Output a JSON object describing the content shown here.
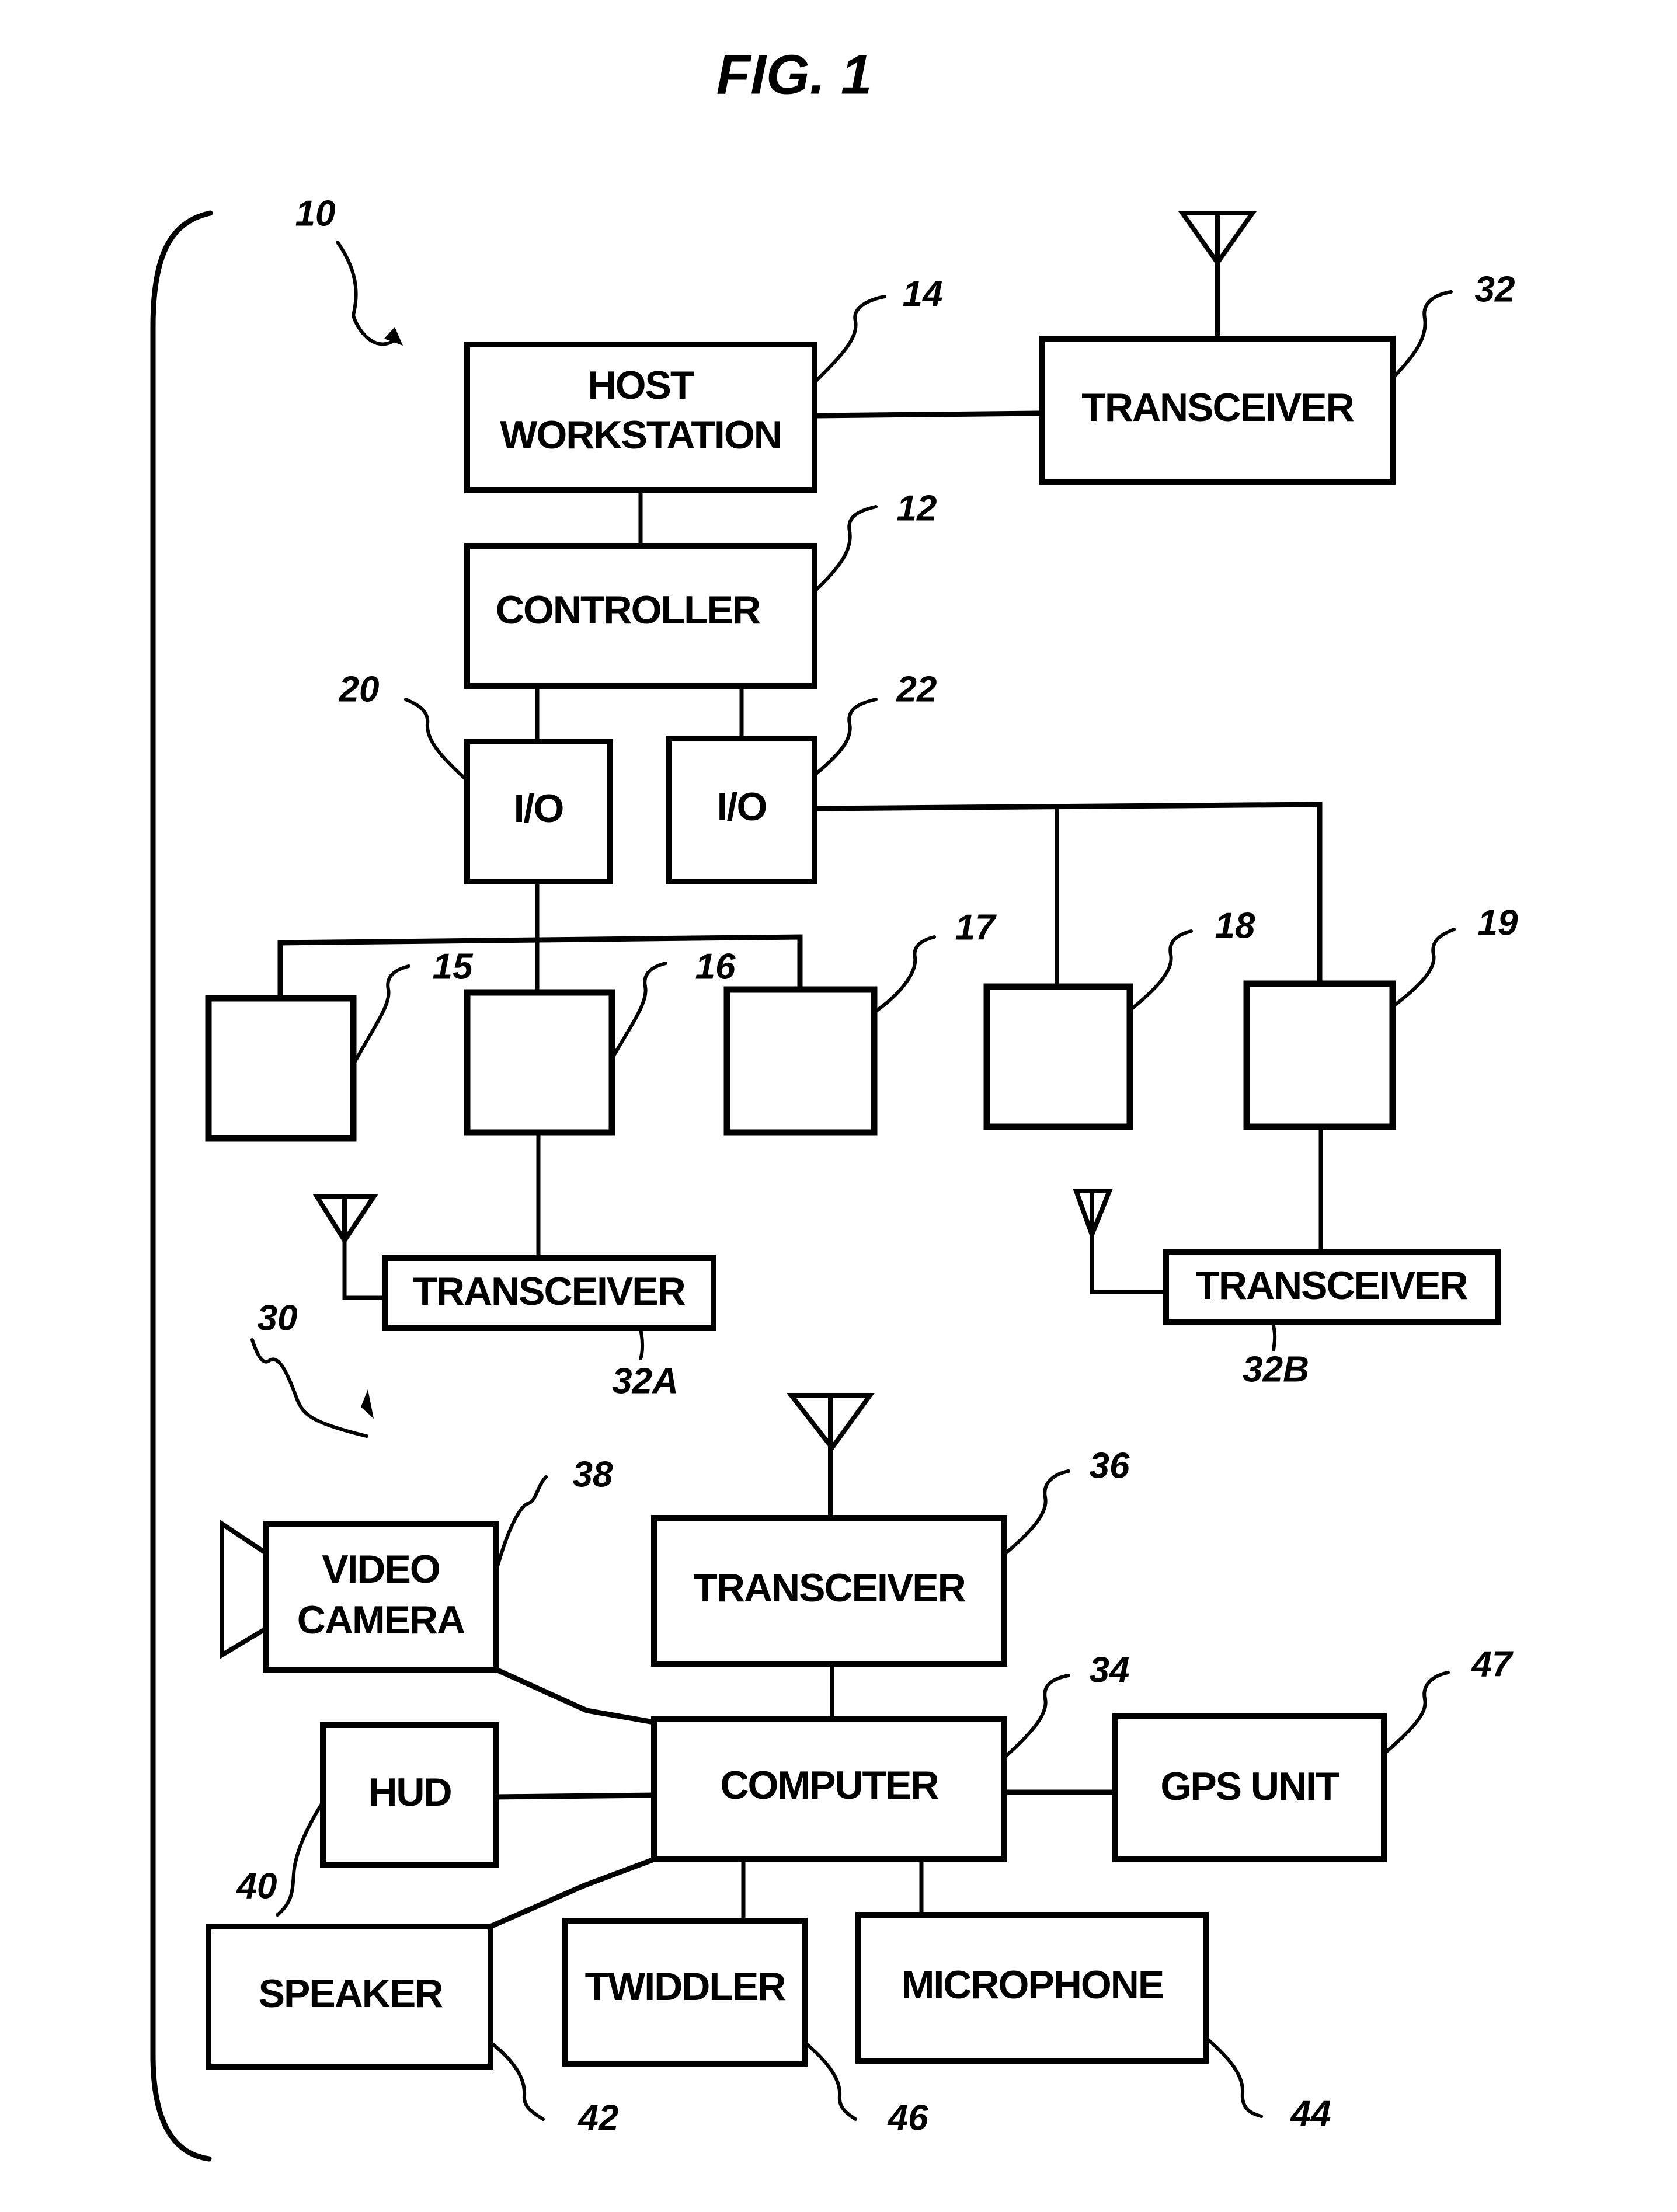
{
  "figure": {
    "title": "FIG. 1",
    "system_refs": {
      "base_system": "10",
      "mobile_system": "30"
    }
  },
  "colors": {
    "ink": "#000000",
    "paper": "#ffffff"
  },
  "base_system": {
    "host_workstation": {
      "line1": "HOST",
      "line2": "WORKSTATION",
      "ref": "14"
    },
    "transceiver": {
      "label": "TRANSCEIVER",
      "ref": "32",
      "icon": "antenna-icon"
    },
    "controller": {
      "label": "CONTROLLER",
      "ref": "12"
    },
    "io_left": {
      "label": "I/O",
      "ref": "20"
    },
    "io_right": {
      "label": "I/O",
      "ref": "22"
    },
    "devices": [
      {
        "ref": "15",
        "label": ""
      },
      {
        "ref": "16",
        "label": ""
      },
      {
        "ref": "17",
        "label": ""
      },
      {
        "ref": "18",
        "label": ""
      },
      {
        "ref": "19",
        "label": ""
      }
    ],
    "transceiver_a": {
      "label": "TRANSCEIVER",
      "ref": "32A",
      "icon": "antenna-icon"
    },
    "transceiver_b": {
      "label": "TRANSCEIVER",
      "ref": "32B",
      "icon": "antenna-icon"
    }
  },
  "mobile_system": {
    "video_camera": {
      "line1": "VIDEO",
      "line2": "CAMERA",
      "ref": "38",
      "icon": "camera-lens-icon"
    },
    "transceiver": {
      "label": "TRANSCEIVER",
      "ref": "36",
      "icon": "antenna-icon"
    },
    "computer": {
      "label": "COMPUTER",
      "ref": "34"
    },
    "gps_unit": {
      "label": "GPS UNIT",
      "ref": "47"
    },
    "hud": {
      "label": "HUD",
      "ref": "40"
    },
    "speaker": {
      "label": "SPEAKER",
      "ref": "42"
    },
    "twiddler": {
      "label": "TWIDDLER",
      "ref": "46"
    },
    "microphone": {
      "label": "MICROPHONE",
      "ref": "44"
    }
  }
}
